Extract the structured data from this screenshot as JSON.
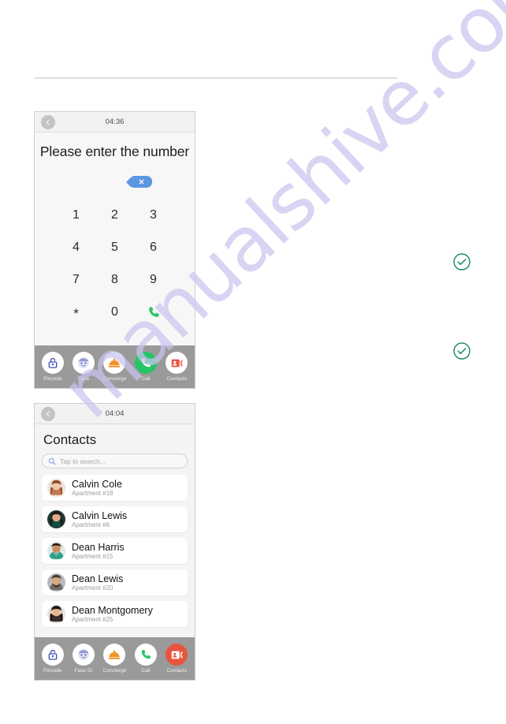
{
  "page": {
    "background": "#ffffff",
    "rule_color": "#dedede",
    "watermark": "manualshive.com",
    "watermark_color": "#c9c6ef"
  },
  "checkmarks": [
    {
      "name": "checkmark-1",
      "icon": "check-circle-icon",
      "color": "#1a8a5a"
    },
    {
      "name": "checkmark-2",
      "icon": "check-circle-icon",
      "color": "#1a8a5a"
    }
  ],
  "phone_dialer": {
    "statusbar": {
      "back_icon": "back-arrow-icon",
      "time": "04:36"
    },
    "title": "Please enter the number",
    "backspace": {
      "icon": "backspace-x-icon",
      "color": "#5b96e0"
    },
    "keypad": [
      {
        "label": "1",
        "name": "keypad-key-1"
      },
      {
        "label": "2",
        "name": "keypad-key-2"
      },
      {
        "label": "3",
        "name": "keypad-key-3"
      },
      {
        "label": "4",
        "name": "keypad-key-4"
      },
      {
        "label": "5",
        "name": "keypad-key-5"
      },
      {
        "label": "6",
        "name": "keypad-key-6"
      },
      {
        "label": "7",
        "name": "keypad-key-7"
      },
      {
        "label": "8",
        "name": "keypad-key-8"
      },
      {
        "label": "9",
        "name": "keypad-key-9"
      },
      {
        "label": "*",
        "name": "keypad-key-star"
      },
      {
        "label": "0",
        "name": "keypad-key-0"
      },
      {
        "label": "",
        "name": "keypad-call-button",
        "icon": "phone-icon"
      }
    ],
    "nav": [
      {
        "label": "Pincode",
        "icon": "padlock-icon",
        "active": false
      },
      {
        "label": "Face",
        "icon": "face-icon",
        "active": false
      },
      {
        "label": "Concierge",
        "icon": "bell-dome-icon",
        "active": false
      },
      {
        "label": "Call",
        "icon": "phone-icon",
        "active": true
      },
      {
        "label": "Contacts",
        "icon": "contact-card-icon",
        "active": false
      }
    ]
  },
  "phone_contacts": {
    "statusbar": {
      "back_icon": "back-arrow-icon",
      "time": "04:04"
    },
    "title": "Contacts",
    "search": {
      "icon": "search-icon",
      "placeholder": "Tap to search...",
      "value": ""
    },
    "contacts": [
      {
        "name": "Calvin Cole",
        "apartment": "Apartment #18",
        "avatar_hue": "#b87a5e"
      },
      {
        "name": "Calvin Lewis",
        "apartment": "Apartment #6",
        "avatar_hue": "#2f2b2e"
      },
      {
        "name": "Dean Harris",
        "apartment": "Apartment #15",
        "avatar_hue": "#2fa18a"
      },
      {
        "name": "Dean Lewis",
        "apartment": "Apartment #20",
        "avatar_hue": "#8a8a8a"
      },
      {
        "name": "Dean Montgomery",
        "apartment": "Apartment #25",
        "avatar_hue": "#3a2f2c"
      }
    ],
    "nav": [
      {
        "label": "Pincode",
        "icon": "padlock-icon",
        "active": false
      },
      {
        "label": "Face ID",
        "icon": "face-icon",
        "active": false
      },
      {
        "label": "Concierge",
        "icon": "bell-dome-icon",
        "active": false
      },
      {
        "label": "Call",
        "icon": "phone-icon",
        "active": false
      },
      {
        "label": "Contacts",
        "icon": "contact-card-icon",
        "active": true
      }
    ]
  }
}
